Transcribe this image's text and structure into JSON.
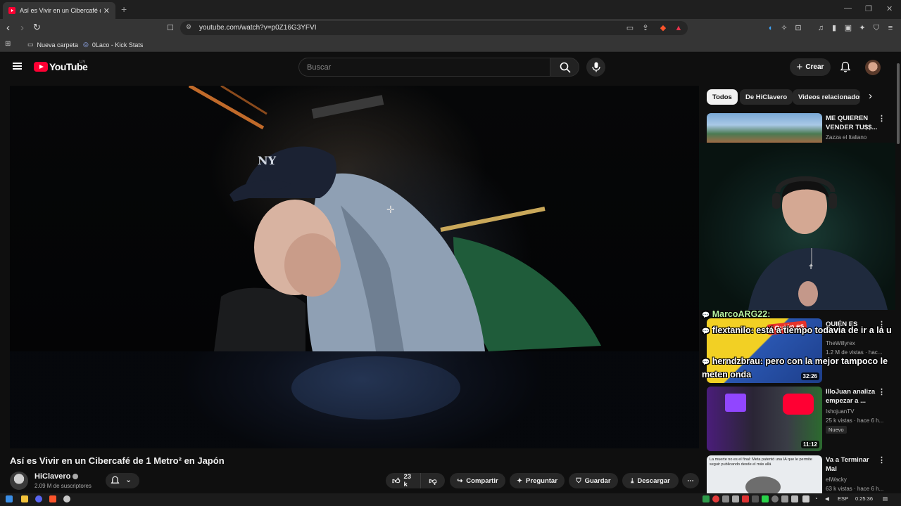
{
  "browser": {
    "tab_title": "Así es Vivir en un Cibercafé de 1",
    "url": "youtube.com/watch?v=p0Z16G3YFVI",
    "bookmarks": [
      "Nueva carpeta",
      "0Laco - Kick Stats"
    ]
  },
  "header": {
    "logo_text": "YouTube",
    "country_code": "UY",
    "search_placeholder": "Buscar",
    "create_label": "Crear"
  },
  "video": {
    "title": "Así es Vivir en un Cibercafé de 1 Metro² en Japón",
    "channel": "HiClavero",
    "subscribers": "2.09 M de suscriptores",
    "likes": "23 k",
    "actions": [
      "Compartir",
      "Preguntar",
      "Guardar",
      "Descargar"
    ]
  },
  "sidebar": {
    "chips": [
      "Todos",
      "De HiClavero",
      "Videos relacionados"
    ],
    "videos": [
      {
        "title": "ME QUIEREN VENDER TU$$...",
        "channel": "Zazza el Italiano",
        "meta": "",
        "duration": "",
        "badge": ""
      },
      {
        "title": "QUIÉN ES",
        "channel": "TheWillyrex",
        "meta": "1.2 M de vistas · hac...",
        "duration": "32:26",
        "badge": ""
      },
      {
        "title": "IlloJuan analiza empezar a ...",
        "channel": "IshojuanTV",
        "meta": "25 k vistas · hace 6 h...",
        "duration": "11:12",
        "badge": "Nuevo"
      },
      {
        "title": "Va a Terminar Mal",
        "channel": "elWacky",
        "meta": "63 k vistas · hace 6 h...",
        "duration": "",
        "badge": ""
      }
    ],
    "thumb_texts": {
      "t2": "¿Quién es",
      "t4": "La muerte no es el final: Meta patentó una IA que le permite seguir publicando desde el más allá"
    }
  },
  "chat_overlay": [
    {
      "user": "MarcoARG22:",
      "text": ""
    },
    {
      "user": "flextanilo:",
      "text": "está a tiempo todavia de ir a la u"
    },
    {
      "user": "herndzbrau:",
      "text": "pero con la mejor tampoco le"
    },
    {
      "user": "",
      "text": "meten onda"
    }
  ],
  "taskbar": {
    "lang": "ESP",
    "time": "0:25:36"
  }
}
